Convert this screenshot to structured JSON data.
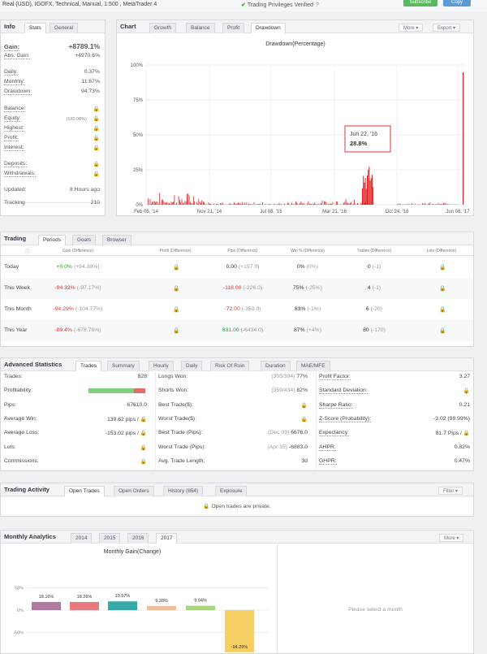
{
  "topbar": {
    "account": "Real (USD), IGOFX, Technical, Manual, 1:500 , MetaTrader 4",
    "verified": "Trading Privileges Verified",
    "btn_green": "Subscribe",
    "btn_blue": "Copy"
  },
  "info": {
    "title": "Info",
    "tabs": [
      "Stats",
      "General"
    ],
    "gain_label": "Gain:",
    "gain_value": "+8789.1%",
    "abs_gain_label": "Abs. Gain:",
    "abs_gain_value": "+4970.6%",
    "rates": [
      {
        "label": "Daily:",
        "value": "0.37%"
      },
      {
        "label": "Monthly:",
        "value": "11.67%"
      },
      {
        "label": "Drawdown:",
        "value": "94.73%"
      }
    ],
    "locked": [
      {
        "label": "Balance:",
        "value": ""
      },
      {
        "label": "Equity:",
        "value": "(100.00%)"
      },
      {
        "label": "Highest:",
        "value": ""
      },
      {
        "label": "Profit:",
        "value": ""
      },
      {
        "label": "Interest:",
        "value": ""
      }
    ],
    "deposits": [
      {
        "label": "Deposits:"
      },
      {
        "label": "Withdrawals:"
      }
    ],
    "updated_label": "Updated:",
    "updated_value": "8 Hours ago",
    "tracking_label": "Tracking",
    "tracking_value": "210"
  },
  "chart_panel": {
    "title": "Chart",
    "tabs": [
      "Growth",
      "Balance",
      "Profit",
      "Drawdown"
    ],
    "more": "More",
    "export": "Export"
  },
  "chart_data": [
    {
      "type": "bar",
      "title": "Drawdown(Percentage)",
      "ylim": [
        0,
        100
      ],
      "yticks": [
        "100%",
        "75%",
        "50%",
        "25%",
        "0%"
      ],
      "xticks": [
        "Feb 05, '14",
        "Nov 21, '14",
        "Jul 08, '15",
        "Mar 21, '16",
        "Oct 24, '16",
        "Jun 06, '17"
      ],
      "tooltip": {
        "date": "Jun 22, '16",
        "value": "28.8%"
      },
      "notable_points": [
        {
          "x": "Jun 22, '16",
          "y": 28.8
        },
        {
          "x": "Jun 06, '17",
          "y": 94.73
        }
      ]
    },
    {
      "type": "bar",
      "title": "Monthly Gain(Change)",
      "ylim": [
        -100,
        50
      ],
      "yticks": [
        "50%",
        "0%",
        "-50%"
      ],
      "values": [
        18.16,
        18.26,
        19.57,
        9.38,
        9.94,
        -94.29
      ],
      "labels": [
        "18.16%",
        "18.26%",
        "19.57%",
        "9.38%",
        "9.94%",
        "-94.29%"
      ]
    }
  ],
  "trading": {
    "title": "Trading",
    "tabs": [
      "Periods",
      "Goals",
      "Browser"
    ],
    "headers": [
      "Gain (Difference)",
      "Profit (Difference)",
      "Pips (Difference)",
      "Win % (Difference)",
      "Trades (Difference)",
      "Lots (Difference)"
    ],
    "rows": [
      {
        "period": "Today",
        "gain": "+0.0%",
        "gain_diff": "(+94.39%)",
        "pips": "0.00",
        "pips_diff": "(+157.0)",
        "win": "0%",
        "win_diff": "(0%)",
        "trades": "0",
        "trades_diff": "(-1)"
      },
      {
        "period": "This Week",
        "gain": "-94.32%",
        "gain_diff": "(-97.17%)",
        "pips": "-118.00",
        "pips_diff": "(-226.0)",
        "win": "75%",
        "win_diff": "(-25%)",
        "trades": "4",
        "trades_diff": "(-1)"
      },
      {
        "period": "This Month",
        "gain": "-94.29%",
        "gain_diff": "(-104.77%)",
        "pips": "-72.00",
        "pips_diff": "(-359.0)",
        "win": "83%",
        "win_diff": "(-1%)",
        "trades": "6",
        "trades_diff": "(-20)"
      },
      {
        "period": "This Year",
        "gain": "-89.4%",
        "gain_diff": "(-678.76%)",
        "pips": "831.00",
        "pips_diff": "(-6434.0)",
        "win": "87%",
        "win_diff": "(+4%)",
        "trades": "80",
        "trades_diff": "(-170)"
      }
    ]
  },
  "advanced": {
    "title": "Advanced Statistics",
    "tabs": [
      "Trades",
      "Summary",
      "Hourly",
      "Daily",
      "Risk Of Ruin",
      "Duration",
      "MAE/MFE"
    ],
    "col1": [
      {
        "label": "Trades:",
        "value": "828"
      },
      {
        "label": "Profitability:",
        "value": ""
      },
      {
        "label": "Pips:",
        "value": "67610.0"
      },
      {
        "label": "Average Win:",
        "value": "139.62 pips /"
      },
      {
        "label": "Average Loss:",
        "value": "-153.02 pips /"
      },
      {
        "label": "Lots:",
        "value": ""
      },
      {
        "label": "Commissions:",
        "value": ""
      }
    ],
    "col2": [
      {
        "label": "Longs Won:",
        "note": "(305/394)",
        "value": "77%"
      },
      {
        "label": "Shorts Won:",
        "note": "(359/434)",
        "value": "82%"
      },
      {
        "label": "Best Trade($):",
        "note": "",
        "value": ""
      },
      {
        "label": "Worst Trade($):",
        "note": "",
        "value": ""
      },
      {
        "label": "Best Trade (Pips):",
        "note": "(Dec 09)",
        "value": "6676.0"
      },
      {
        "label": "Worst Trade (Pips):",
        "note": "(Apr 15)",
        "value": "-6883.0"
      },
      {
        "label": "Avg. Trade Length:",
        "note": "",
        "value": "3d"
      }
    ],
    "col3": [
      {
        "label": "Profit Factor:",
        "value": "3.27"
      },
      {
        "label": "Standard Deviation:",
        "value": ""
      },
      {
        "label": "Sharpe Ratio:",
        "value": "0.21"
      },
      {
        "label": "Z-Score (Probability):",
        "value": "-3.02 (99.99%)"
      },
      {
        "label": "Expectancy:",
        "value": "81.7 Pips /"
      },
      {
        "label": "AHPR:",
        "value": "0.82%"
      },
      {
        "label": "GHPR:",
        "value": "0.47%"
      }
    ],
    "profitability_win_fraction": 0.8
  },
  "activity": {
    "title": "Trading Activity",
    "tabs": [
      "Open Trades",
      "Open Orders",
      "History (854)",
      "Exposure"
    ],
    "filter": "Filter",
    "message": "Open trades are private."
  },
  "monthly": {
    "title": "Monthly Analytics",
    "tabs": [
      "2014",
      "2015",
      "2016",
      "2017"
    ],
    "more": "More",
    "select_msg": "Please select a month"
  },
  "colors": {
    "accent_green": "#2f9a2f",
    "loss_red": "#d43a3a",
    "lock": "#d8a200",
    "drawdown_bar": "#e02020"
  }
}
